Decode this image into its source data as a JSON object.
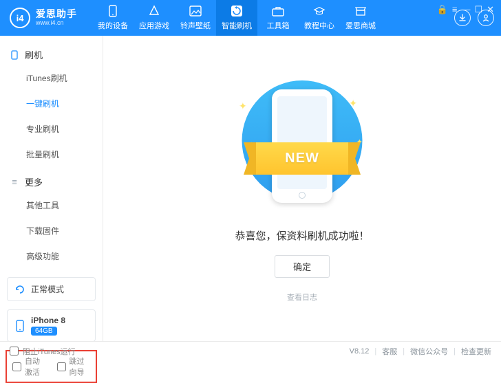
{
  "header": {
    "brand": "爱思助手",
    "url": "www.i4.cn",
    "nav": [
      {
        "label": "我的设备"
      },
      {
        "label": "应用游戏"
      },
      {
        "label": "铃声壁纸"
      },
      {
        "label": "智能刷机"
      },
      {
        "label": "工具箱"
      },
      {
        "label": "教程中心"
      },
      {
        "label": "爱思商城"
      }
    ]
  },
  "sidebar": {
    "section1": {
      "title": "刷机",
      "items": [
        "iTunes刷机",
        "一键刷机",
        "专业刷机",
        "批量刷机"
      ]
    },
    "section2": {
      "title": "更多",
      "items": [
        "其他工具",
        "下载固件",
        "高级功能"
      ]
    },
    "mode": "正常模式",
    "device": {
      "name": "iPhone 8",
      "storage": "64GB"
    },
    "checkboxes": {
      "autoActivate": "自动激活",
      "skipWizard": "跳过向导"
    }
  },
  "main": {
    "ribbon": "NEW",
    "success": "恭喜您，保资料刷机成功啦！",
    "ok": "确定",
    "viewLog": "查看日志"
  },
  "status": {
    "blockItunes": "阻止iTunes运行",
    "version": "V8.12",
    "support": "客服",
    "wechat": "微信公众号",
    "checkUpdate": "检查更新"
  }
}
